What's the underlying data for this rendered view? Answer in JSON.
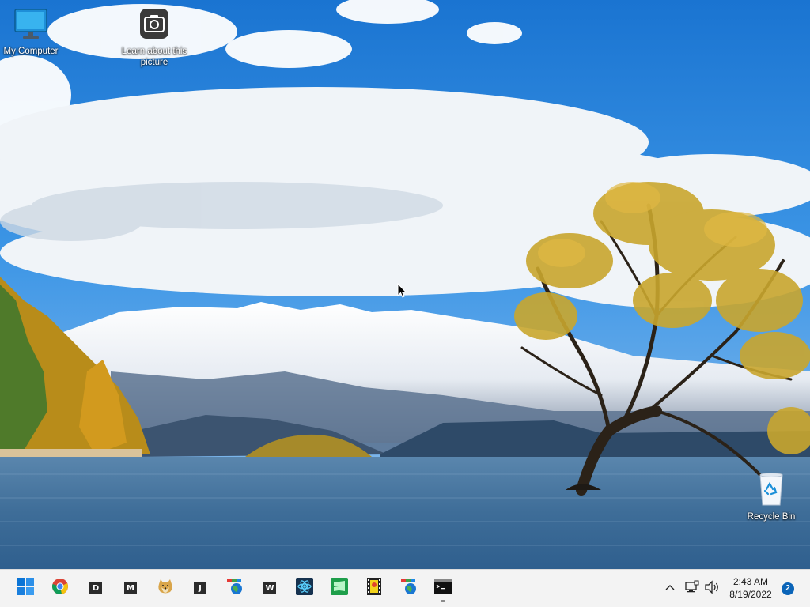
{
  "desktop": {
    "icons": [
      {
        "label": "My Computer",
        "icon": "monitor-icon"
      },
      {
        "label": "Learn about this picture",
        "icon": "camera-icon"
      },
      {
        "label": "Recycle Bin",
        "icon": "recycle-bin-icon"
      }
    ],
    "wallpaper": "lake-tree-mountains-landscape"
  },
  "taskbar": {
    "apps": [
      {
        "name": "start",
        "icon": "windows-start-icon"
      },
      {
        "name": "chrome",
        "icon": "chrome-icon"
      },
      {
        "name": "d",
        "letter": "D",
        "icon": "d-app-icon"
      },
      {
        "name": "m",
        "letter": "M",
        "icon": "m-app-icon"
      },
      {
        "name": "doge",
        "icon": "doge-icon"
      },
      {
        "name": "j",
        "letter": "J",
        "icon": "j-app-icon"
      },
      {
        "name": "globe-app-1",
        "icon": "globe-network-icon"
      },
      {
        "name": "w",
        "letter": "W",
        "icon": "w-app-icon"
      },
      {
        "name": "atom",
        "icon": "atom-icon"
      },
      {
        "name": "green-windows",
        "icon": "windows-flag-icon"
      },
      {
        "name": "filmstrip",
        "icon": "film-strip-icon"
      },
      {
        "name": "globe-app-2",
        "icon": "globe-network-icon"
      },
      {
        "name": "terminal",
        "icon": "terminal-icon",
        "running": true
      }
    ],
    "tray": {
      "chevron": "chevron-up-icon",
      "network": "network-icon",
      "volume": "volume-icon",
      "time": "2:43 AM",
      "date": "8/19/2022",
      "notifications": "2"
    }
  },
  "colors": {
    "sky": "#1f7ed6",
    "taskbar_bg": "#f3f3f3",
    "accent": "#0a64b8"
  }
}
